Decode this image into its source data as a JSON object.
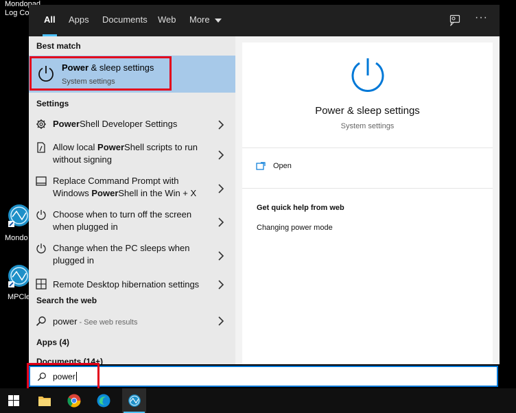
{
  "desktop": {
    "top_label_1": "Mondopad",
    "top_label_2": "Log Col",
    "icon1_label": "Mondo",
    "icon2_label": "MPCle"
  },
  "tabs": [
    {
      "label": "All",
      "active": true
    },
    {
      "label": "Apps"
    },
    {
      "label": "Documents"
    },
    {
      "label": "Web"
    },
    {
      "label": "More"
    }
  ],
  "best_match": {
    "header": "Best match",
    "title_bold": "Power",
    "title_rest": " & sleep settings",
    "subtitle": "System settings"
  },
  "settings_header": "Settings",
  "settings_items": [
    {
      "pre": "",
      "bold": "Power",
      "post": "Shell Developer Settings"
    },
    {
      "pre": "Allow local ",
      "bold": "Power",
      "post": "Shell scripts to run without signing"
    },
    {
      "pre": "Replace Command Prompt with Windows ",
      "bold": "Power",
      "post": "Shell in the Win + X"
    },
    {
      "pre": "Choose when to turn off the screen when plugged in",
      "bold": "",
      "post": ""
    },
    {
      "pre": "Change when the PC sleeps when plugged in",
      "bold": "",
      "post": ""
    },
    {
      "pre": "Remote Desktop hibernation settings",
      "bold": "",
      "post": ""
    }
  ],
  "web_header": "Search the web",
  "web_item": {
    "query": "power",
    "suffix": " - See web results"
  },
  "apps_header": "Apps (4)",
  "docs_header": "Documents (14+)",
  "detail": {
    "title": "Power & sleep settings",
    "subtitle": "System settings",
    "open_label": "Open",
    "help_header": "Get quick help from web",
    "help_link": "Changing power mode"
  },
  "search": {
    "value": "power"
  },
  "colors": {
    "accent": "#0078d7",
    "highlight_box": "#e3001b",
    "selection": "#a7c9e9"
  }
}
